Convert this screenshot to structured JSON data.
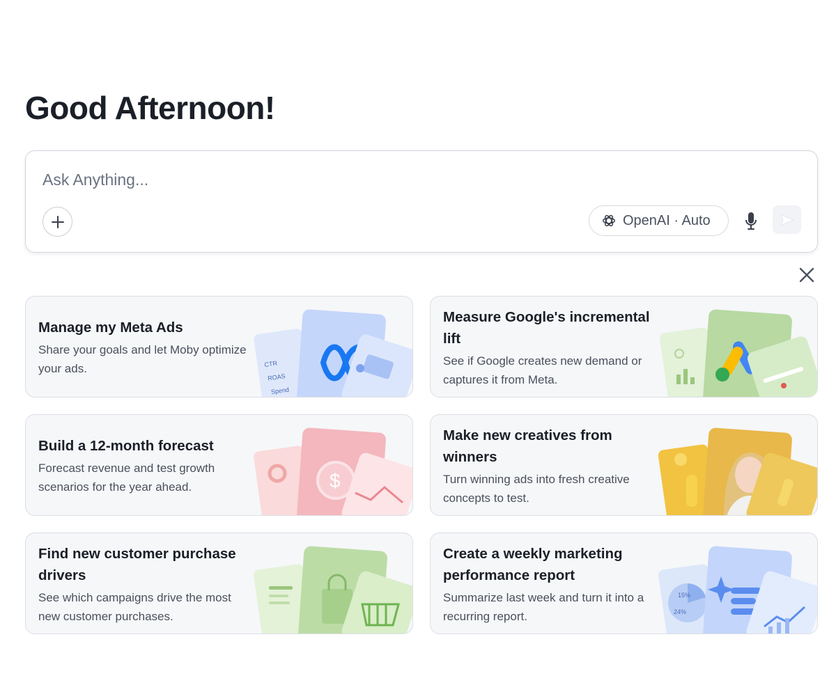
{
  "greeting": "Good Afternoon!",
  "composer": {
    "placeholder": "Ask Anything...",
    "model_label": "OpenAI · Auto",
    "icons": {
      "add": "plus-icon",
      "model": "openai-logo-icon",
      "mic": "microphone-icon",
      "send": "send-icon"
    }
  },
  "close_icon": "close-icon",
  "cards": [
    {
      "title": "Manage my Meta Ads",
      "desc": "Share your goals and let Moby optimize your ads.",
      "art_labels": [
        "CTR",
        "ROAS",
        "Spend"
      ]
    },
    {
      "title": "Measure Google's incremental lift",
      "desc": "See if Google creates new demand or captures it from Meta."
    },
    {
      "title": "Build a 12-month forecast",
      "desc": "Forecast revenue and test growth scenarios for the year ahead."
    },
    {
      "title": "Make new creatives from winners",
      "desc": "Turn winning ads into fresh creative concepts to test."
    },
    {
      "title": "Find new customer purchase drivers",
      "desc": "See which campaigns drive the most new customer purchases."
    },
    {
      "title": "Create a weekly marketing performance report",
      "desc": "Summarize last week and turn it into a recurring report.",
      "art_labels": [
        "15%",
        "24%"
      ]
    }
  ],
  "colors": {
    "meta": "#1877f2",
    "google_yellow": "#fbbc04",
    "google_blue": "#4285f4",
    "google_green": "#34a853"
  }
}
